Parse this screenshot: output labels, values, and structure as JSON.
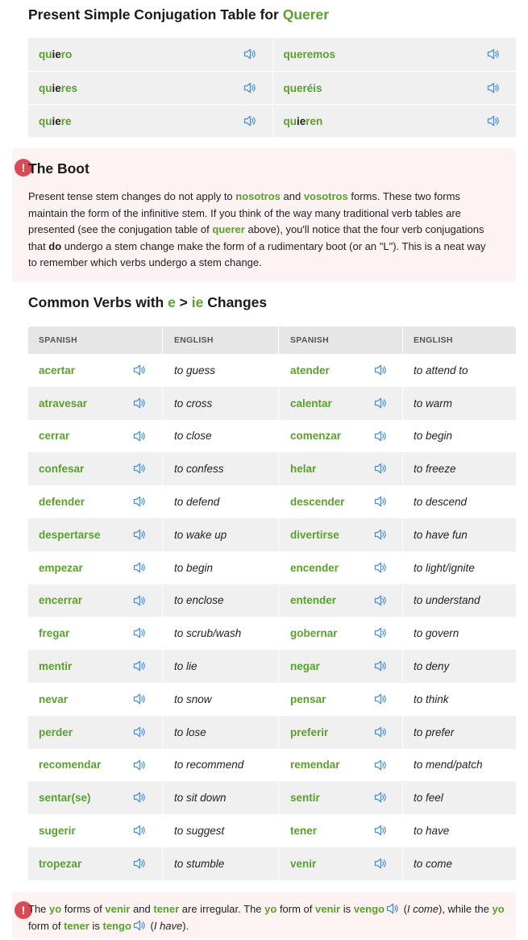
{
  "section1": {
    "title_prefix": "Present Simple Conjugation Table for",
    "title_verb": "Querer",
    "rows": [
      {
        "l_stem": "qu",
        "l_mid": "ie",
        "l_end": "ro",
        "r_stem": "",
        "r_mid": "",
        "r_end": "queremos"
      },
      {
        "l_stem": "qu",
        "l_mid": "ie",
        "l_end": "res",
        "r_stem": "",
        "r_mid": "",
        "r_end": "queréis"
      },
      {
        "l_stem": "qu",
        "l_mid": "ie",
        "l_end": "re",
        "r_stem": "qu",
        "r_mid": "ie",
        "r_end": "ren"
      }
    ]
  },
  "boot": {
    "title": "The Boot",
    "t1": "Present tense stem changes do not apply to ",
    "w1": "nosotros",
    "t2": " and ",
    "w2": "vosotros",
    "t3": " forms. These two forms maintain the form of the infinitive stem. If you think of the way many traditional verb tables are presented (see the conjugation table of ",
    "w3": "querer",
    "t4": " above), you'll notice that the four verb conjugations that ",
    "w4": "do",
    "t5": " undergo a stem change make the form of a rudimentary boot (or an \"L\"). This is a neat way to remember which verbs undergo a stem change."
  },
  "section2": {
    "title_a": "Common Verbs with ",
    "title_e": "e",
    "title_gt": " > ",
    "title_ie": "ie",
    "title_b": " Changes",
    "headers": [
      "SPANISH",
      "ENGLISH",
      "SPANISH",
      "ENGLISH"
    ],
    "rows": [
      [
        "acertar",
        "to guess",
        "atender",
        "to attend to"
      ],
      [
        "atravesar",
        "to cross",
        "calentar",
        "to warm"
      ],
      [
        "cerrar",
        "to close",
        "comenzar",
        "to begin"
      ],
      [
        "confesar",
        "to confess",
        "helar",
        "to freeze"
      ],
      [
        "defender",
        "to defend",
        "descender",
        "to descend"
      ],
      [
        "despertarse",
        "to wake up",
        "divertirse",
        "to have fun"
      ],
      [
        "empezar",
        "to begin",
        "encender",
        "to light/ignite"
      ],
      [
        "encerrar",
        "to enclose",
        "entender",
        "to understand"
      ],
      [
        "fregar",
        "to scrub/wash",
        "gobernar",
        "to govern"
      ],
      [
        "mentir",
        "to lie",
        "negar",
        "to deny"
      ],
      [
        "nevar",
        "to snow",
        "pensar",
        "to think"
      ],
      [
        "perder",
        "to lose",
        "preferir",
        "to prefer"
      ],
      [
        "recomendar",
        "to recommend",
        "remendar",
        "to mend/patch"
      ],
      [
        "sentar(se)",
        "to sit down",
        "sentir",
        "to feel"
      ],
      [
        "sugerir",
        "to suggest",
        "tener",
        "to have"
      ],
      [
        "tropezar",
        "to stumble",
        "venir",
        "to come"
      ]
    ]
  },
  "note2": {
    "t1": "The ",
    "w1": "yo",
    "t2": " forms of ",
    "w2": "venir",
    "t3": " and ",
    "w3": "tener",
    "t4": " are irregular. The ",
    "w4": "yo",
    "t5": " form of ",
    "w5": "venir",
    "t6": " is ",
    "w6": "vengo",
    "t7": " (",
    "i1": "I come",
    "t8": "), while the ",
    "w7": "yo",
    "t9": " form of ",
    "w8": "tener",
    "t10": " is ",
    "w9": "tengo",
    "t11": " (",
    "i2": "I have",
    "t12": ")."
  },
  "colors": {
    "accent": "#5aa02c",
    "speaker": "#4a90d9",
    "alert": "#d94a57",
    "note_bg": "#fdf3f3"
  }
}
